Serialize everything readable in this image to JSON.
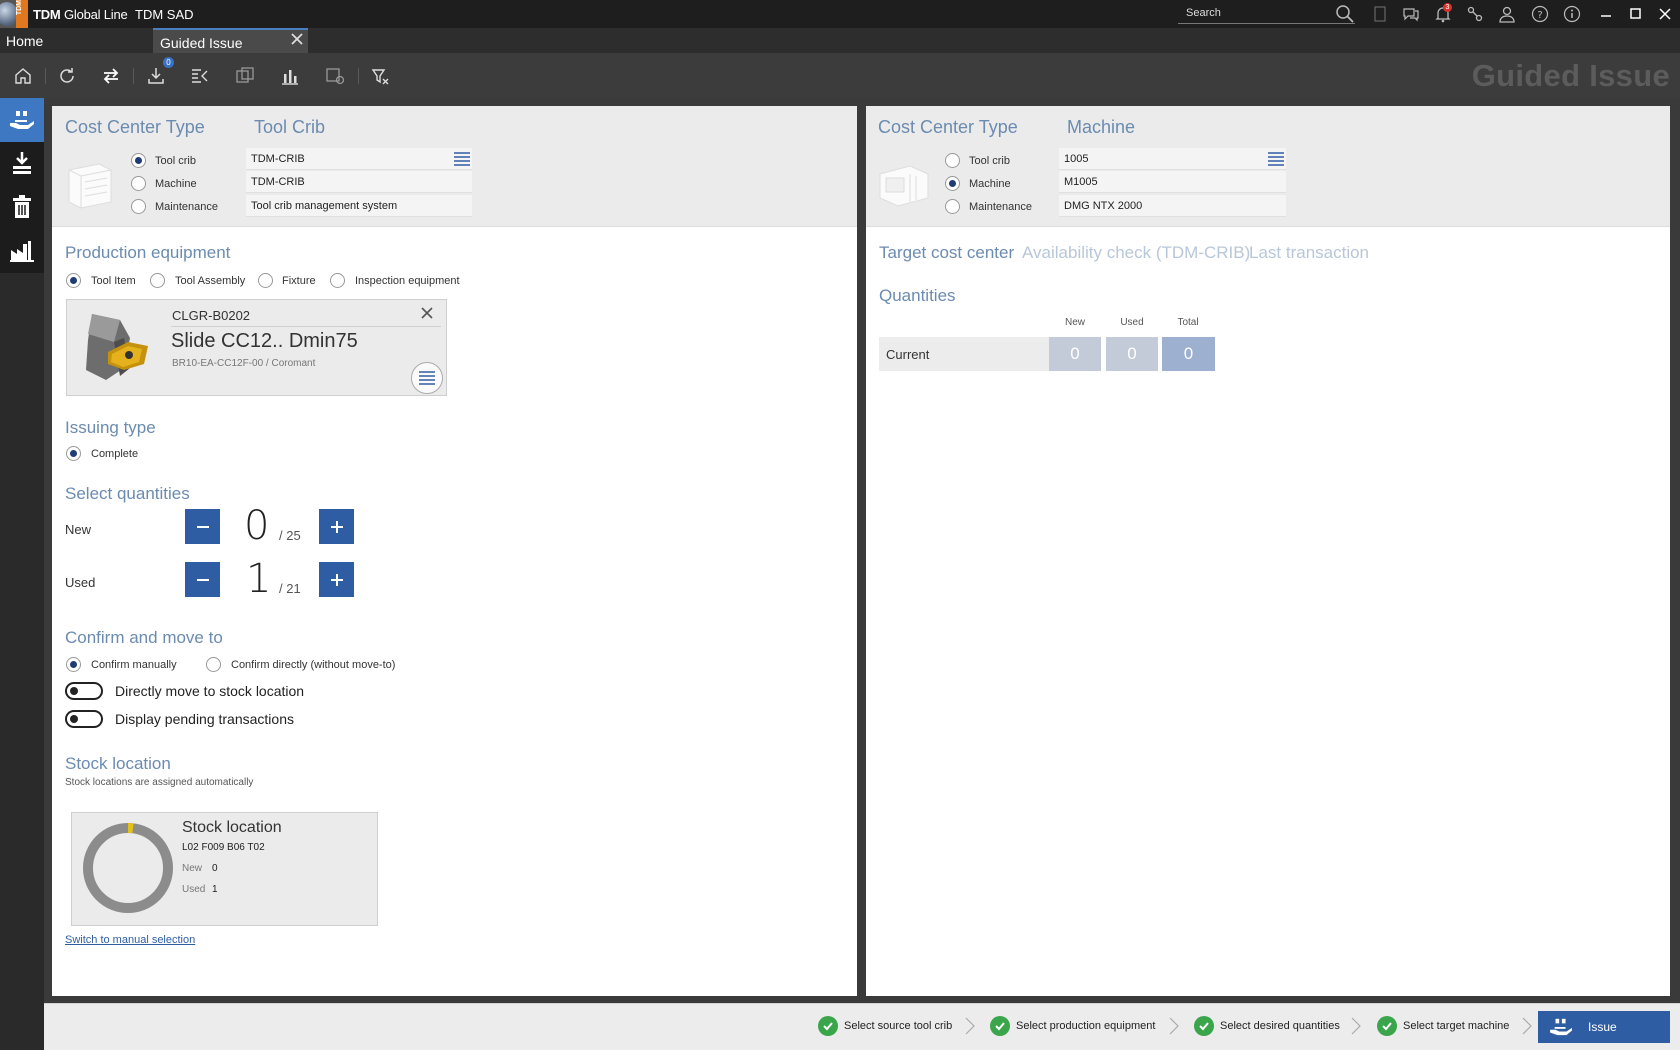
{
  "app": {
    "brand": "TDM",
    "name": "Global Line",
    "module": "TDM SAD",
    "logo_text": "TDM"
  },
  "search": {
    "placeholder": "Search"
  },
  "notifications": {
    "count": "3"
  },
  "tabs": [
    {
      "label": "Home"
    },
    {
      "label": "Guided Issue"
    }
  ],
  "toolbar": {
    "badge": "0",
    "page_title": "Guided Issue"
  },
  "source": {
    "label": "Cost Center Type",
    "type_name": "Tool Crib",
    "options": [
      "Tool crib",
      "Machine",
      "Maintenance"
    ],
    "selected": "Tool crib",
    "fields": [
      "TDM-CRIB",
      "TDM-CRIB",
      "Tool crib management system"
    ]
  },
  "target": {
    "label": "Cost Center Type",
    "type_name": "Machine",
    "options": [
      "Tool crib",
      "Machine",
      "Maintenance"
    ],
    "selected": "Machine",
    "fields": [
      "1005",
      "M1005",
      "DMG NTX 2000"
    ]
  },
  "production": {
    "title": "Production equipment",
    "options": [
      "Tool Item",
      "Tool Assembly",
      "Fixture",
      "Inspection equipment"
    ],
    "selected": "Tool Item",
    "item": {
      "id": "CLGR-B0202",
      "name": "Slide CC12.. Dmin75",
      "desc": "BR10-EA-CC12F-00 / Coromant"
    }
  },
  "issuing": {
    "title": "Issuing type",
    "option": "Complete"
  },
  "quantities": {
    "title": "Select quantities",
    "new": {
      "label": "New",
      "value": "0",
      "max": "/ 25"
    },
    "used": {
      "label": "Used",
      "value": "1",
      "max": "/ 21"
    }
  },
  "confirm": {
    "title": "Confirm and move to",
    "options": [
      "Confirm manually",
      "Confirm directly (without move-to)"
    ],
    "selected": "Confirm manually",
    "toggles": [
      {
        "label": "Directly move to stock location",
        "on": false
      },
      {
        "label": "Display pending transactions",
        "on": false
      }
    ]
  },
  "stock": {
    "title": "Stock location",
    "subtitle": "Stock locations are assigned automatically",
    "card_title": "Stock location",
    "code": "L02 F009 B06 T02",
    "new_label": "New",
    "new_value": "0",
    "used_label": "Used",
    "used_value": "1",
    "fill_fraction": 0.02,
    "link": "Switch to manual selection"
  },
  "right": {
    "tabs": [
      "Target cost center",
      "Availability check (TDM-CRIB)",
      "Last transaction"
    ],
    "active_tab": "Target cost center",
    "quantities_title": "Quantities",
    "columns": [
      "New",
      "Used",
      "Total"
    ],
    "row_label": "Current",
    "values": [
      "0",
      "0",
      "0"
    ]
  },
  "steps": [
    {
      "label": "Select source tool crib"
    },
    {
      "label": "Select production equipment"
    },
    {
      "label": "Select desired quantities"
    },
    {
      "label": "Select target machine"
    }
  ],
  "issue_button": {
    "label": "Issue"
  },
  "colors": {
    "accent": "#2f5da3",
    "success": "#3aa54b",
    "notification": "#d8342b",
    "title_bar": "#1e1e1e"
  }
}
